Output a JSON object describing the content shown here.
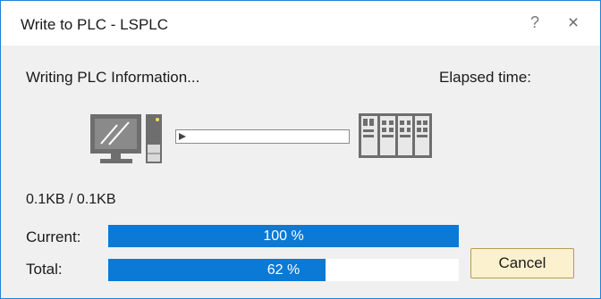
{
  "window": {
    "title": "Write to PLC - LSPLC",
    "help_glyph": "?",
    "close_glyph": "×"
  },
  "status": {
    "message": "Writing PLC Information...",
    "elapsed_label": "Elapsed time:",
    "size_text": "0.1KB / 0.1KB"
  },
  "icons": {
    "computer": "computer-icon",
    "transfer_arrow": "transfer-arrow-icon",
    "plc": "plc-icon"
  },
  "progress": {
    "current": {
      "label": "Current:",
      "percent": 100,
      "text": "100 %"
    },
    "total": {
      "label": "Total:",
      "percent": 62,
      "text": "62 %"
    }
  },
  "buttons": {
    "cancel": "Cancel"
  },
  "colors": {
    "accent": "#0b79d6",
    "border": "#1f83d8",
    "button_bg": "#fbf1cf"
  }
}
